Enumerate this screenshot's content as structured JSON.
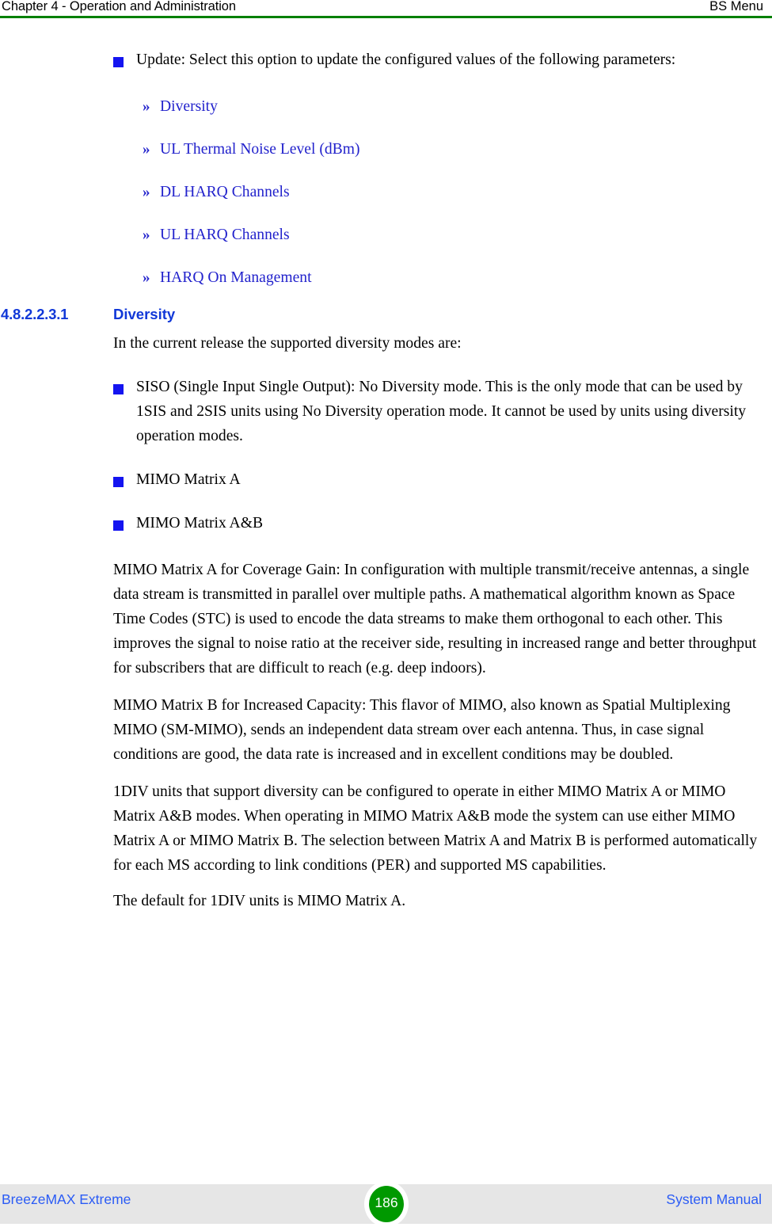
{
  "header": {
    "left": "Chapter 4 - Operation and Administration",
    "right": "BS Menu",
    "rule_color": "#008000"
  },
  "content": {
    "update_bullet": "Update: Select this option to update the configured values of the following parameters:",
    "xref_marker": "»",
    "xref_items": [
      {
        "label": "Diversity"
      },
      {
        "label": "UL Thermal Noise Level (dBm)"
      },
      {
        "label": "DL HARQ Channels"
      },
      {
        "label": "UL HARQ Channels"
      },
      {
        "label": "HARQ On Management"
      }
    ],
    "heading": {
      "number": "4.8.2.2.3.1",
      "title": "Diversity",
      "color": "#1138d8"
    },
    "intro_para": "In the current release the supported diversity modes are:",
    "mode_bullets": [
      {
        "text": "SISO (Single Input Single Output): No Diversity mode. This is the only mode that can be used by 1SIS and 2SIS units using No Diversity operation mode. It cannot be used by units using diversity operation modes."
      },
      {
        "text": "MIMO Matrix A"
      },
      {
        "text": "MIMO Matrix A&B"
      }
    ],
    "paragraphs": [
      "MIMO Matrix A for Coverage Gain: In configuration with multiple transmit/receive antennas, a single data stream is transmitted in parallel over multiple paths. A mathematical algorithm known as Space Time Codes (STC) is used to encode the data streams to make them orthogonal to each other. This improves the signal to noise ratio at the receiver side, resulting in increased range and better throughput for subscribers that are difficult to reach (e.g. deep indoors).",
      "MIMO Matrix B for Increased Capacity: This flavor of MIMO, also known as Spatial Multiplexing MIMO (SM-MIMO), sends an independent data stream over each antenna. Thus, in case signal conditions are good, the data rate is increased and in excellent conditions may be doubled.",
      "1DIV units that support diversity can be configured to operate in either MIMO Matrix A or MIMO Matrix A&B modes. When operating in MIMO Matrix A&B mode the system can use either MIMO Matrix A or MIMO Matrix B. The selection between Matrix A and Matrix B is performed automatically for each MS according to link conditions (PER) and supported MS capabilities.",
      "The default for 1DIV units is MIMO Matrix A."
    ],
    "bullet_color": "#1414f0",
    "link_color": "#2222cc"
  },
  "footer": {
    "left": "BreezeMAX Extreme",
    "page_number": "186",
    "right": "System Manual",
    "band_color": "#e6e6e6",
    "badge_color": "#009900",
    "text_color": "#2a5bf5"
  }
}
